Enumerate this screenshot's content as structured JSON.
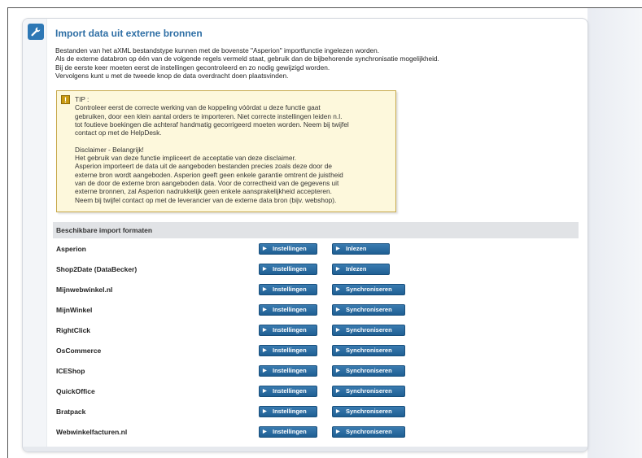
{
  "page": {
    "title": "Import data uit externe bronnen",
    "intro_lines": [
      "Bestanden van het aXML bestandstype kunnen met de bovenste \"Asperion\" importfunctie ingelezen worden.",
      "Als de externe databron op één van de volgende regels vermeld staat, gebruik dan de bijbehorende synchronisatie mogelijkheid.",
      "Bij de eerste keer moeten eerst de instellingen gecontroleerd en zo nodig gewijzigd worden.",
      "Vervolgens kunt u met de tweede knop de data overdracht doen plaatsvinden."
    ]
  },
  "tip": {
    "icon_glyph": "!",
    "lines": [
      "TIP :",
      "Controleer eerst de correcte werking van de koppeling vóórdat u deze functie gaat",
      "gebruiken, door een klein aantal orders te importeren. Niet correcte instellingen leiden n.l.",
      "tot foutieve boekingen die achteraf handmatig gecorrigeerd moeten worden. Neem bij twijfel",
      "contact op met de HelpDesk.",
      "",
      "Disclaimer - Belangrijk!",
      "Het gebruik van deze functie impliceert de acceptatie van deze disclaimer.",
      "Asperion importeert de data uit de aangeboden bestanden precies zoals deze door de",
      "externe bron wordt aangeboden. Asperion geeft geen enkele garantie omtrent de juistheid",
      "van de door de externe bron aangeboden data. Voor de correctheid van de gegevens uit",
      "externe bronnen, zal Asperion nadrukkelijk geen enkele aansprakelijkheid accepteren.",
      "Neem bij twijfel contact op met de leverancier van de externe data bron (bijv. webshop)."
    ]
  },
  "formats": {
    "heading": "Beschikbare import formaten",
    "settings_label": "Instellingen",
    "items": [
      {
        "name": "Asperion",
        "action": "Inlezen"
      },
      {
        "name": "Shop2Date (DataBecker)",
        "action": "Inlezen"
      },
      {
        "name": "Mijnwebwinkel.nl",
        "action": "Synchroniseren"
      },
      {
        "name": "MijnWinkel",
        "action": "Synchroniseren"
      },
      {
        "name": "RightClick",
        "action": "Synchroniseren"
      },
      {
        "name": "OsCommerce",
        "action": "Synchroniseren"
      },
      {
        "name": "ICEShop",
        "action": "Synchroniseren"
      },
      {
        "name": "QuickOffice",
        "action": "Synchroniseren"
      },
      {
        "name": "Bratpack",
        "action": "Synchroniseren"
      },
      {
        "name": "Webwinkelfacturen.nl",
        "action": "Synchroniseren"
      }
    ]
  },
  "icons": {
    "header": "tools-icon",
    "tip": "warning-icon",
    "button_arrow": "play-arrow-icon"
  },
  "colors": {
    "title": "#2f6fa5",
    "button": "#2a6ca2",
    "tip_background": "#fdf8dc",
    "tip_border": "#c7a94b"
  }
}
